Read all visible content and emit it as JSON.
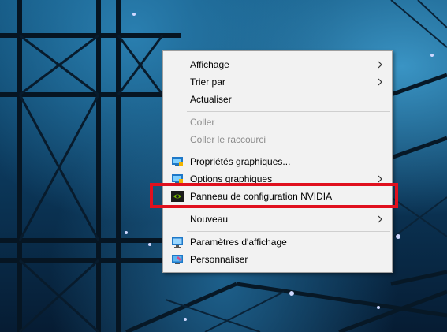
{
  "context_menu": {
    "items": [
      {
        "label": "Affichage"
      },
      {
        "label": "Trier par"
      },
      {
        "label": "Actualiser"
      },
      {
        "label": "Coller"
      },
      {
        "label": "Coller le raccourci"
      },
      {
        "label": "Propriétés graphiques..."
      },
      {
        "label": "Options graphiques"
      },
      {
        "label": "Panneau de configuration NVIDIA"
      },
      {
        "label": "Nouveau"
      },
      {
        "label": "Paramètres d'affichage"
      },
      {
        "label": "Personnaliser"
      }
    ]
  },
  "highlight": {
    "color": "#e0101e",
    "target": "Panneau de configuration NVIDIA"
  },
  "icons": [
    "intel-graphics-icon",
    "nvidia-icon",
    "display-settings-icon",
    "personalize-icon",
    "chevron-right-icon"
  ],
  "colors": {
    "menu_background": "#f2f2f2",
    "disabled_text": "#8c8c8c",
    "nvidia_green": "#76b900"
  }
}
